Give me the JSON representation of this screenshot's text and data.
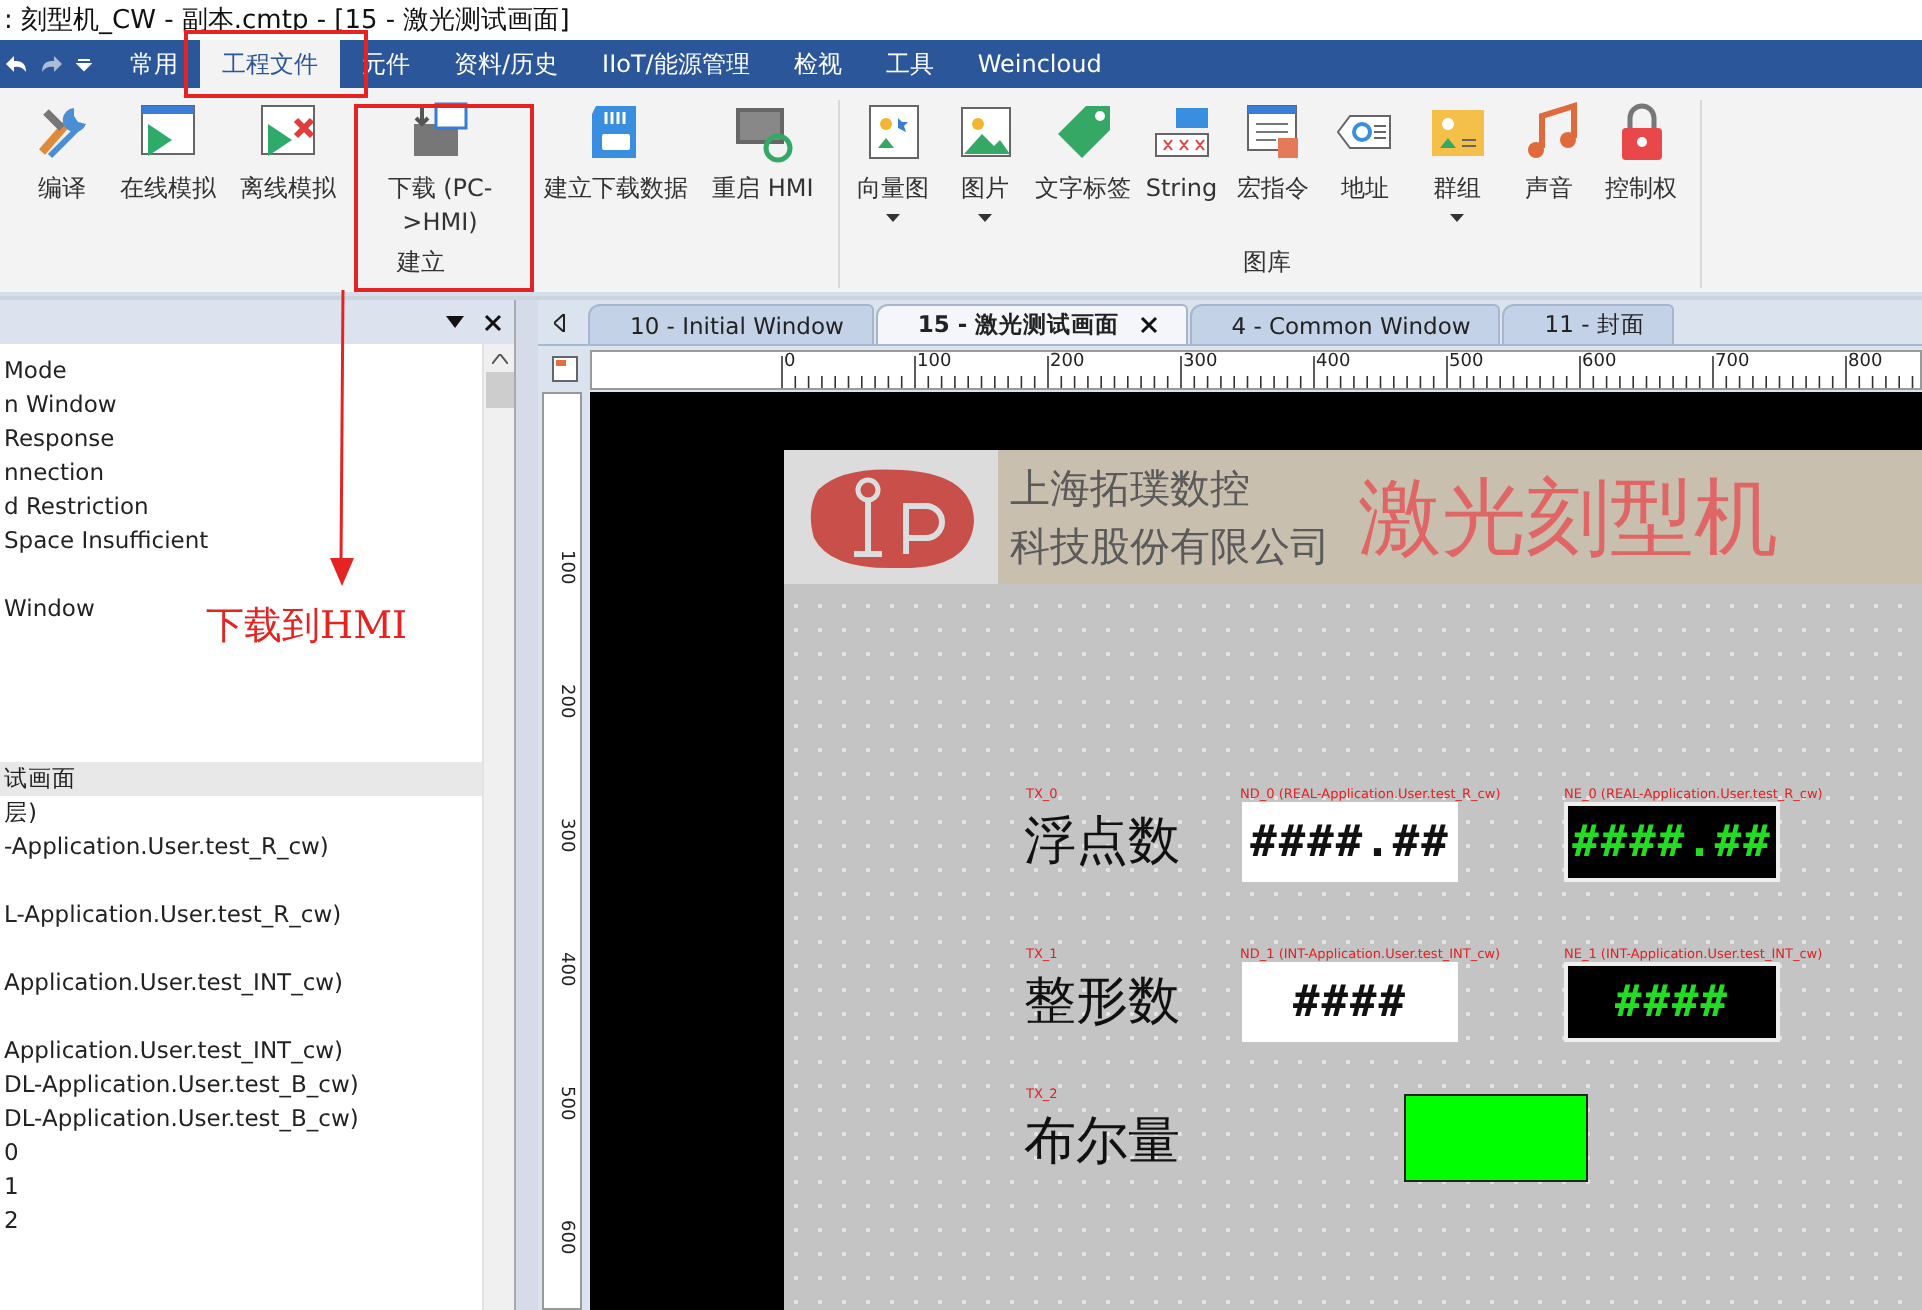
{
  "window": {
    "title": ": 刻型机_CW - 副本.cmtp - [15 - 激光测试画面]"
  },
  "menu_tabs": [
    {
      "label": "常用",
      "selected": false
    },
    {
      "label": "工程文件",
      "selected": true
    },
    {
      "label": "元件",
      "selected": false
    },
    {
      "label": "资料/历史",
      "selected": false
    },
    {
      "label": "IIoT/能源管理",
      "selected": false
    },
    {
      "label": "检视",
      "selected": false
    },
    {
      "label": "工具",
      "selected": false
    },
    {
      "label": "Weincloud",
      "selected": false
    }
  ],
  "ribbon_groups": [
    {
      "label": "建立",
      "buttons": [
        {
          "label": "编译",
          "dropdown": false
        },
        {
          "label": "在线模拟",
          "dropdown": false
        },
        {
          "label": "离线模拟",
          "dropdown": false
        },
        {
          "label": "下载 (PC->HMI)",
          "dropdown": false
        },
        {
          "label": "建立下载数据",
          "dropdown": false
        },
        {
          "label": "重启 HMI",
          "dropdown": false
        }
      ]
    },
    {
      "label": "图库",
      "buttons": [
        {
          "label": "向量图",
          "dropdown": true
        },
        {
          "label": "图片",
          "dropdown": true
        },
        {
          "label": "文字标签",
          "dropdown": false
        },
        {
          "label": "String",
          "dropdown": false
        },
        {
          "label": "宏指令",
          "dropdown": false
        },
        {
          "label": "地址",
          "dropdown": false
        },
        {
          "label": "群组",
          "dropdown": true
        },
        {
          "label": "声音",
          "dropdown": false
        },
        {
          "label": "控制权",
          "dropdown": false
        }
      ]
    }
  ],
  "annotation": {
    "text": "下载到HMI"
  },
  "tree": [
    {
      "kind": "line",
      "label": "Mode",
      "selected": false
    },
    {
      "kind": "line",
      "label": "n Window",
      "selected": false
    },
    {
      "kind": "line",
      "label": "Response",
      "selected": false
    },
    {
      "kind": "line",
      "label": "nnection",
      "selected": false
    },
    {
      "kind": "line",
      "label": "d Restriction",
      "selected": false
    },
    {
      "kind": "line",
      "label": "Space Insufficient",
      "selected": false
    },
    {
      "kind": "blank"
    },
    {
      "kind": "line",
      "label": "Window",
      "selected": false
    },
    {
      "kind": "blank"
    },
    {
      "kind": "blank"
    },
    {
      "kind": "blank"
    },
    {
      "kind": "blank"
    },
    {
      "kind": "line",
      "label": "试画面",
      "selected": true
    },
    {
      "kind": "line",
      "label": "层)",
      "selected": false
    },
    {
      "kind": "line",
      "label": "-Application.User.test_R_cw)",
      "selected": false
    },
    {
      "kind": "blank"
    },
    {
      "kind": "line",
      "label": "L-Application.User.test_R_cw)",
      "selected": false
    },
    {
      "kind": "blank"
    },
    {
      "kind": "line",
      "label": "Application.User.test_INT_cw)",
      "selected": false
    },
    {
      "kind": "blank"
    },
    {
      "kind": "line",
      "label": "Application.User.test_INT_cw)",
      "selected": false
    },
    {
      "kind": "line",
      "label": "DL-Application.User.test_B_cw)",
      "selected": false
    },
    {
      "kind": "line",
      "label": "DL-Application.User.test_B_cw)",
      "selected": false
    },
    {
      "kind": "line",
      "label": "0",
      "selected": false
    },
    {
      "kind": "line",
      "label": "1",
      "selected": false
    },
    {
      "kind": "line",
      "label": "2",
      "selected": false
    }
  ],
  "editor_tabs": [
    {
      "label": "10 - Initial Window",
      "selected": false
    },
    {
      "label": "15 - 激光测试画面",
      "selected": true
    },
    {
      "label": "4 - Common Window",
      "selected": false
    },
    {
      "label": "11 - 封面",
      "selected": false
    }
  ],
  "ruler": {
    "horizontal": [
      "0",
      "100",
      "200",
      "300",
      "400",
      "500",
      "600",
      "700",
      "800"
    ],
    "vertical": [
      "100",
      "200",
      "300",
      "400",
      "500",
      "600"
    ]
  },
  "screen": {
    "banner": {
      "company_line_1": "上海拓璞数控",
      "company_line_2": "科技股份有限公司",
      "title": "激光刻型机"
    },
    "rows": [
      {
        "tag": "TX_0",
        "label": "浮点数",
        "kind": "numeric",
        "display_tag": "ND_0 (REAL-Application.User.test_R_cw)",
        "display_value": "####.##",
        "input_tag": "NE_0 (REAL-Application.User.test_R_cw)",
        "input_value": "####.##"
      },
      {
        "tag": "TX_1",
        "label": "整形数",
        "kind": "numeric",
        "display_tag": "ND_1 (INT-Application.User.test_INT_cw)",
        "display_value": "####",
        "input_tag": "NE_1 (INT-Application.User.test_INT_cw)",
        "input_value": "####"
      },
      {
        "tag": "TX_2",
        "label": "布尔量",
        "kind": "lamp",
        "on": true
      }
    ]
  }
}
